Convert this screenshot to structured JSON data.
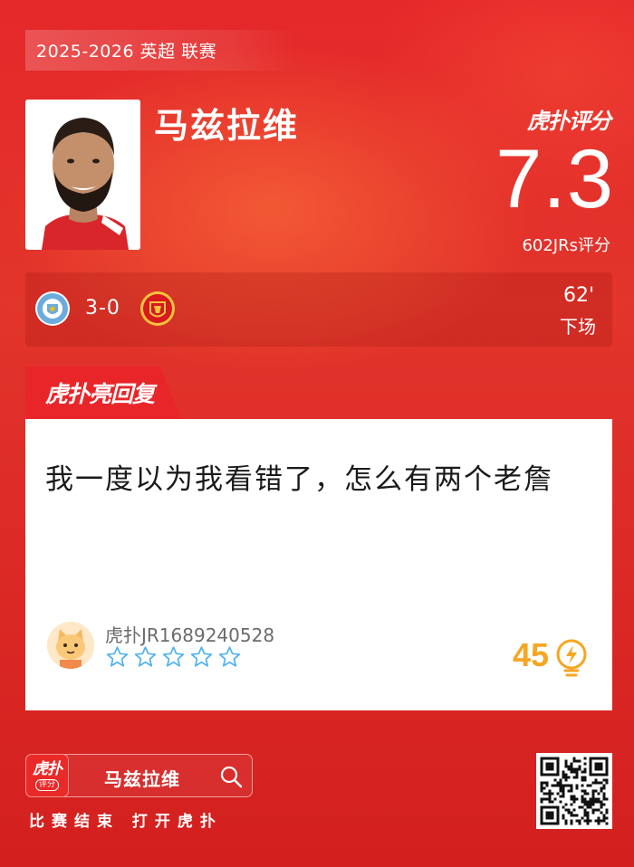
{
  "header": {
    "season_tag": "2025-2026 英超 联赛"
  },
  "player": {
    "name": "马兹拉维"
  },
  "rating": {
    "brand": "虎扑评分",
    "score": "7.3",
    "count_label": "602JRs评分"
  },
  "match": {
    "home_team_icon": "manchester-city-crest",
    "away_team_icon": "manchester-united-crest",
    "score": "3-0",
    "minute": "62'",
    "status": "下场"
  },
  "reply": {
    "label": "虎扑亮回复",
    "text": "我一度以为我看错了，怎么有两个老詹",
    "username": "虎扑JR1689240528",
    "stars_filled": 0,
    "stars_total": 5,
    "likes": "45",
    "like_icon": "lightbulb-icon"
  },
  "footer": {
    "app_logo_name": "虎扑",
    "app_logo_sub": "评分",
    "search_query": "马兹拉维",
    "caption": "比赛结束 打开虎扑"
  },
  "colors": {
    "background": "#e2352b",
    "accent_red": "#e8262a",
    "like_orange": "#f5a623",
    "star_blue": "#4fb3f0"
  }
}
